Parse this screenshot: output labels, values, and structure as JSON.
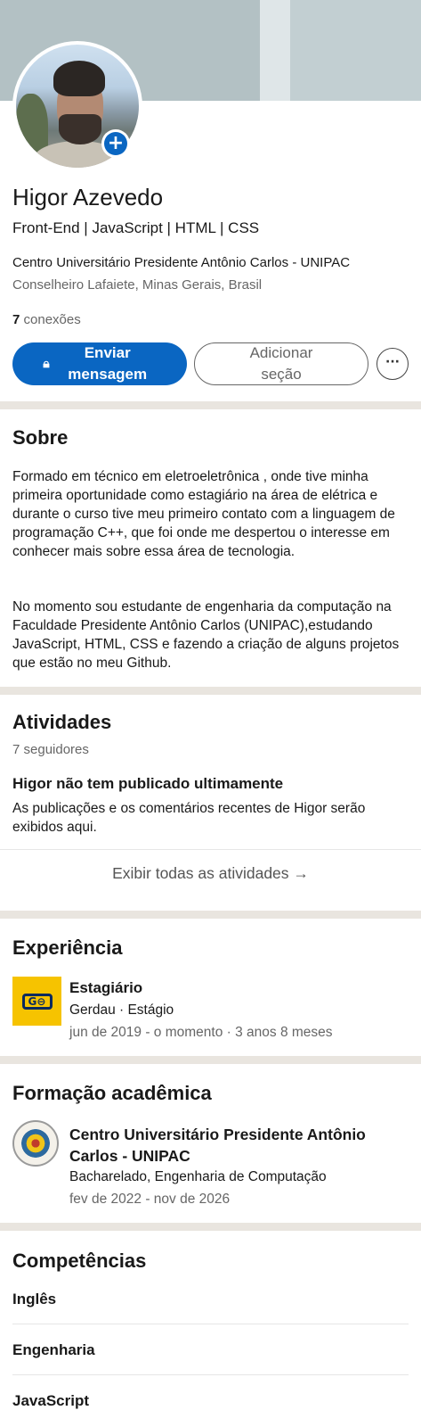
{
  "profile": {
    "name": "Higor Azevedo",
    "headline": "Front-End | JavaScript | HTML | CSS",
    "school": "Centro Universitário Presidente Antônio Carlos - UNIPAC",
    "location": "Conselheiro Lafaiete, Minas Gerais, Brasil",
    "connections_count": "7",
    "connections_label": "conexões",
    "add_photo_icon": "plus-icon"
  },
  "actions": {
    "message_label": "Enviar mensagem",
    "message_icon": "lock-icon",
    "add_section_label": "Adicionar seção",
    "more_label": "···"
  },
  "about": {
    "title": "Sobre",
    "paragraph_1": "Formado em técnico em eletroeletrônica , onde tive minha primeira oportunidade como estagiário na área de elétrica e durante o curso tive meu primeiro contato com a linguagem de programação C++, que foi onde me despertou o interesse em conhecer mais sobre essa área de tecnologia.",
    "paragraph_2": "No momento sou estudante de engenharia da computação na Faculdade Presidente Antônio Carlos (UNIPAC),estudando JavaScript, HTML, CSS e fazendo a criação de alguns projetos que estão no meu Github."
  },
  "activity": {
    "title": "Atividades",
    "followers": "7 seguidores",
    "empty_title": "Higor não tem publicado ultimamente",
    "empty_body": "As publicações e os comentários recentes de Higor serão exibidos aqui.",
    "show_all": "Exibir todas as atividades →"
  },
  "experience": {
    "title": "Experiência",
    "items": [
      {
        "role": "Estagiário",
        "company": "Gerdau · Estágio",
        "dates": "jun de 2019 - o momento · 3 anos 8 meses",
        "logo_text": "G⊖"
      }
    ]
  },
  "education": {
    "title": "Formação acadêmica",
    "items": [
      {
        "school": "Centro Universitário Presidente Antônio Carlos - UNIPAC",
        "degree": "Bacharelado, Engenharia de Computação",
        "dates": "fev de 2022 - nov de 2026"
      }
    ]
  },
  "skills": {
    "title": "Competências",
    "items": [
      "Inglês",
      "Engenharia",
      "JavaScript"
    ]
  },
  "colors": {
    "primary": "#0a66c2",
    "divider": "#e9e5df",
    "muted_text": "#666666",
    "gerdau_yellow": "#f6c300"
  }
}
